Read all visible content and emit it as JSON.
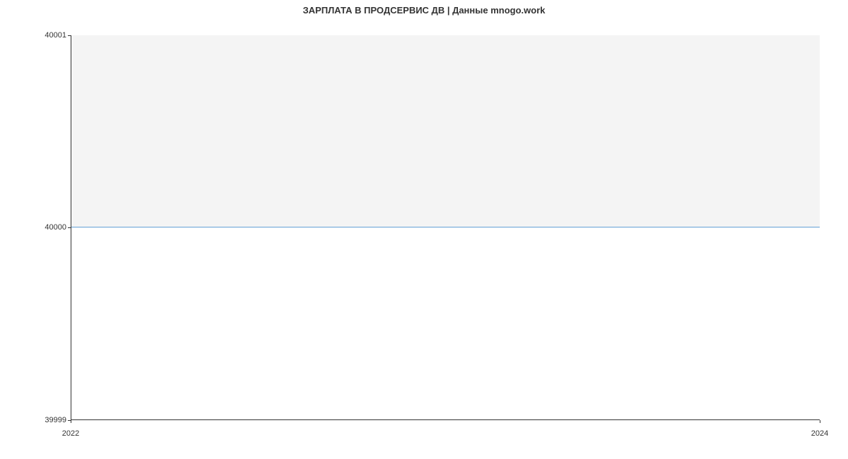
{
  "chart_data": {
    "type": "line",
    "title": "ЗАРПЛАТА В ПРОДСЕРВИС ДВ | Данные mnogo.work",
    "xlabel": "",
    "ylabel": "",
    "x": [
      2022,
      2024
    ],
    "values": [
      40000,
      40000
    ],
    "ylim": [
      39999,
      40001
    ],
    "xlim": [
      2022,
      2024
    ],
    "y_ticks": [
      39999,
      40000,
      40001
    ],
    "x_ticks": [
      2022,
      2024
    ]
  },
  "labels": {
    "y_top": "40001",
    "y_mid": "40000",
    "y_bottom": "39999",
    "x_left": "2022",
    "x_right": "2024"
  }
}
